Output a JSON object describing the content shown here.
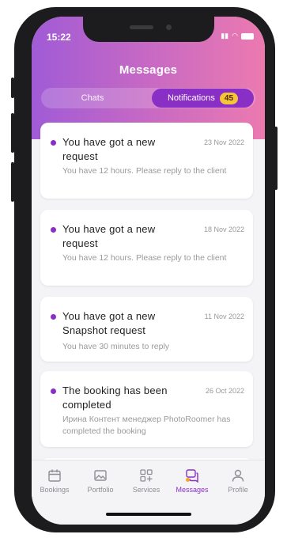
{
  "status": {
    "time": "15:22"
  },
  "header": {
    "title": "Messages"
  },
  "tabs": {
    "chats": "Chats",
    "notifications": "Notifications",
    "notifications_count": "45"
  },
  "notifications": [
    {
      "title": "You have got a new request",
      "date": "23 Nov 2022",
      "body": "You have 12 hours. Please reply to the client"
    },
    {
      "title": "You have got a new request",
      "date": "18 Nov 2022",
      "body": "You have 12 hours. Please reply to the client"
    },
    {
      "title": "You have got a new Snapshot request",
      "date": "11 Nov 2022",
      "body": "You have 30 minutes to reply"
    },
    {
      "title": "The booking has been completed",
      "date": "26 Oct 2022",
      "body": "Ирина Контент менеджер PhotoRoomer has completed the booking"
    }
  ],
  "tabbar": {
    "items": [
      {
        "label": "Bookings",
        "icon": "calendar-icon"
      },
      {
        "label": "Portfolio",
        "icon": "image-icon"
      },
      {
        "label": "Services",
        "icon": "grid-plus-icon"
      },
      {
        "label": "Messages",
        "icon": "chat-icon",
        "active": true
      },
      {
        "label": "Profile",
        "icon": "user-icon"
      }
    ]
  },
  "colors": {
    "accent": "#8a2fc6",
    "badge": "#f5c437",
    "gradient_start": "#a05bd6",
    "gradient_end": "#ec7ab0"
  }
}
